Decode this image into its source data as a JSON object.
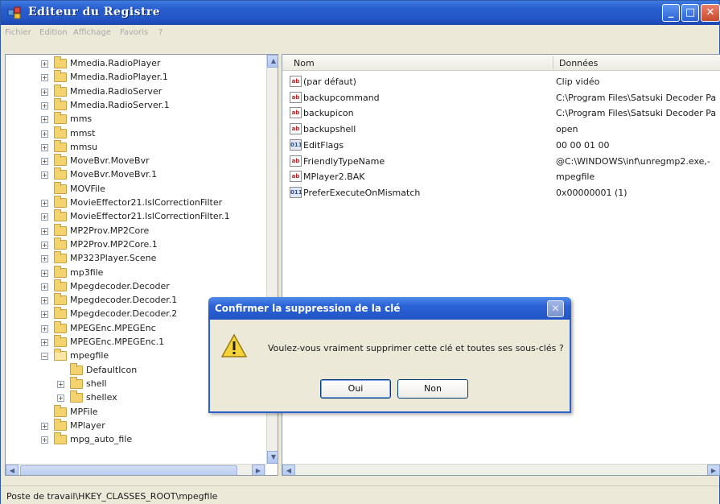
{
  "window": {
    "title": "Editeur du Registre",
    "min_glyph": "_",
    "max_glyph": "□",
    "close_glyph": "✕"
  },
  "menu": [
    "Fichier",
    "Edition",
    "Affichage",
    "Favoris",
    "?"
  ],
  "tree": {
    "items": [
      {
        "label": "Mmedia.RadioPlayer",
        "indent": 0,
        "expander": "+",
        "open": false
      },
      {
        "label": "Mmedia.RadioPlayer.1",
        "indent": 0,
        "expander": "+",
        "open": false
      },
      {
        "label": "Mmedia.RadioServer",
        "indent": 0,
        "expander": "+",
        "open": false
      },
      {
        "label": "Mmedia.RadioServer.1",
        "indent": 0,
        "expander": "+",
        "open": false
      },
      {
        "label": "mms",
        "indent": 0,
        "expander": "+",
        "open": false
      },
      {
        "label": "mmst",
        "indent": 0,
        "expander": "+",
        "open": false
      },
      {
        "label": "mmsu",
        "indent": 0,
        "expander": "+",
        "open": false
      },
      {
        "label": "MoveBvr.MoveBvr",
        "indent": 0,
        "expander": "+",
        "open": false
      },
      {
        "label": "MoveBvr.MoveBvr.1",
        "indent": 0,
        "expander": "+",
        "open": false
      },
      {
        "label": "MOVFile",
        "indent": 0,
        "expander": "",
        "open": false
      },
      {
        "label": "MovieEffector21.IslCorrectionFilter",
        "indent": 0,
        "expander": "+",
        "open": false
      },
      {
        "label": "MovieEffector21.IslCorrectionFilter.1",
        "indent": 0,
        "expander": "+",
        "open": false
      },
      {
        "label": "MP2Prov.MP2Core",
        "indent": 0,
        "expander": "+",
        "open": false
      },
      {
        "label": "MP2Prov.MP2Core.1",
        "indent": 0,
        "expander": "+",
        "open": false
      },
      {
        "label": "MP323Player.Scene",
        "indent": 0,
        "expander": "+",
        "open": false
      },
      {
        "label": "mp3file",
        "indent": 0,
        "expander": "+",
        "open": false
      },
      {
        "label": "Mpegdecoder.Decoder",
        "indent": 0,
        "expander": "+",
        "open": false
      },
      {
        "label": "Mpegdecoder.Decoder.1",
        "indent": 0,
        "expander": "+",
        "open": false
      },
      {
        "label": "Mpegdecoder.Decoder.2",
        "indent": 0,
        "expander": "+",
        "open": false
      },
      {
        "label": "MPEGEnc.MPEGEnc",
        "indent": 0,
        "expander": "+",
        "open": false
      },
      {
        "label": "MPEGEnc.MPEGEnc.1",
        "indent": 0,
        "expander": "+",
        "open": false
      },
      {
        "label": "mpegfile",
        "indent": 0,
        "expander": "-",
        "open": true
      },
      {
        "label": "DefaultIcon",
        "indent": 1,
        "expander": "",
        "open": false
      },
      {
        "label": "shell",
        "indent": 1,
        "expander": "+",
        "open": false
      },
      {
        "label": "shellex",
        "indent": 1,
        "expander": "+",
        "open": false
      },
      {
        "label": "MPFile",
        "indent": 0,
        "expander": "",
        "open": false
      },
      {
        "label": "MPlayer",
        "indent": 0,
        "expander": "+",
        "open": false
      },
      {
        "label": "mpg_auto_file",
        "indent": 0,
        "expander": "+",
        "open": false
      }
    ]
  },
  "values": {
    "columns": {
      "name": "Nom",
      "data": "Données"
    },
    "rows": [
      {
        "icon": "ab",
        "kind": "sz",
        "name": "(par défaut)",
        "data": "Clip vidéo"
      },
      {
        "icon": "ab",
        "kind": "sz",
        "name": "backupcommand",
        "data": "C:\\Program Files\\Satsuki Decoder Pa"
      },
      {
        "icon": "ab",
        "kind": "sz",
        "name": "backupicon",
        "data": "C:\\Program Files\\Satsuki Decoder Pa"
      },
      {
        "icon": "ab",
        "kind": "sz",
        "name": "backupshell",
        "data": "open"
      },
      {
        "icon": "011",
        "kind": "bin",
        "name": "EditFlags",
        "data": "00 00 01 00"
      },
      {
        "icon": "ab",
        "kind": "sz",
        "name": "FriendlyTypeName",
        "data": "@C:\\WINDOWS\\inf\\unregmp2.exe,-"
      },
      {
        "icon": "ab",
        "kind": "sz",
        "name": "MPlayer2.BAK",
        "data": "mpegfile"
      },
      {
        "icon": "011",
        "kind": "bin",
        "name": "PreferExecuteOnMismatch",
        "data": "0x00000001 (1)"
      }
    ]
  },
  "status": "Poste de travail\\HKEY_CLASSES_ROOT\\mpegfile",
  "dialog": {
    "title": "Confirmer la suppression de la clé",
    "message": "Voulez-vous vraiment supprimer cette clé et toutes ses sous-clés ?",
    "yes": "Oui",
    "no": "Non"
  },
  "colors": {
    "titlebar": "#2457c8",
    "frame": "#ece9d8",
    "folder": "#f3d36d"
  }
}
